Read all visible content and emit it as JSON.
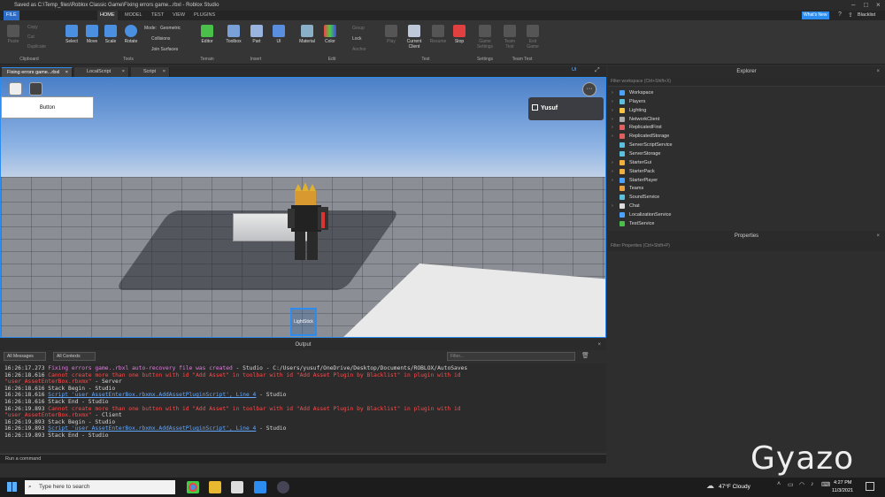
{
  "window": {
    "title": "Saved as C:\\Temp_files\\Roblox Classic Game\\Fixing errors game...rbxl - Roblox Studio"
  },
  "menu": [
    "FILE",
    "HOME",
    "MODEL",
    "TEST",
    "VIEW",
    "PLUGINS"
  ],
  "account": {
    "badge": "What's New",
    "user": "Blacklist"
  },
  "ribbon": {
    "clipboard": {
      "paste": "Paste",
      "copy": "Copy",
      "cut": "Cut",
      "duplicate": "Duplicate",
      "group": "Clipboard"
    },
    "tools": {
      "select": "Select",
      "move": "Move",
      "scale": "Scale",
      "rotate": "Rotate",
      "mode_label": "Mode:",
      "mode_value": "Geometric",
      "collisions": "Collisions",
      "join": "Join Surfaces",
      "group": "Tools"
    },
    "terrain": {
      "editor": "Editor",
      "group": "Terrain"
    },
    "insert": {
      "toolbox": "Toolbox",
      "part": "Part",
      "ui": "UI",
      "group": "Insert"
    },
    "edit": {
      "material": "Material",
      "color": "Color",
      "group_btn": "Group",
      "lock": "Lock",
      "anchor": "Anchor",
      "group": "Edit"
    },
    "test": {
      "play": "Play",
      "current_client": "Current Client",
      "resume": "Resume",
      "stop": "Stop",
      "group": "Test"
    },
    "settings": {
      "game_settings": "Game Settings",
      "group": "Settings"
    },
    "team_test": {
      "team_test": "Team Test",
      "exit_game": "Exit Game",
      "group": "Team Test"
    }
  },
  "doc_tabs": [
    "Fixing errors game...rbxl",
    "LocalScript",
    "Script"
  ],
  "viewport": {
    "button_label": "Button",
    "player_name": "Yusuf",
    "tool_label": "LightStick",
    "ui_label": "UI",
    "more": "···"
  },
  "output": {
    "title": "Output",
    "filter_messages": "All Messages",
    "filter_contexts": "All Contexts",
    "filter_placeholder": "Filter...",
    "lines": [
      {
        "t": "16:26:17.273",
        "parts": [
          {
            "c": "mag",
            "s": "Fixing errors game..rbxl auto-recovery file was created"
          },
          {
            "c": "w",
            "s": "  -  Studio - C:/Users/yusuf/OneDrive/Desktop/Documents/ROBLOX/AutoSaves"
          }
        ]
      },
      {
        "t": "16:26:18.616",
        "parts": [
          {
            "c": "red",
            "s": "Cannot create more than one button with id \"Add Asset\" in toolbar with id \"Add Asset Plugin by Blacklist\" in plugin with id"
          }
        ]
      },
      {
        "t": "",
        "parts": [
          {
            "c": "red",
            "s": "\"user_AssetEnterBox.rbxmx\""
          },
          {
            "c": "w",
            "s": "  -  Server"
          }
        ]
      },
      {
        "t": "16:26:18.616",
        "parts": [
          {
            "c": "w",
            "s": "Stack Begin  -  Studio"
          }
        ]
      },
      {
        "t": "16:26:18.616",
        "parts": [
          {
            "c": "blue",
            "s": "Script 'user_AssetEnterBox.rbxmx.AddAssetPluginScript', Line 4"
          },
          {
            "c": "w",
            "s": "  -  Studio"
          }
        ]
      },
      {
        "t": "16:26:18.616",
        "parts": [
          {
            "c": "w",
            "s": "Stack End  -  Studio"
          }
        ]
      },
      {
        "t": "16:26:19.893",
        "parts": [
          {
            "c": "red",
            "s": "Cannot create more than one button with id \"Add Asset\" in toolbar with id \"Add Asset Plugin by Blacklist\" in plugin with id"
          }
        ]
      },
      {
        "t": "",
        "parts": [
          {
            "c": "red",
            "s": "\"user_AssetEnterBox.rbxmx\""
          },
          {
            "c": "w",
            "s": "  -  Client"
          }
        ]
      },
      {
        "t": "16:26:19.893",
        "parts": [
          {
            "c": "w",
            "s": "Stack Begin  -  Studio"
          }
        ]
      },
      {
        "t": "16:26:19.893",
        "parts": [
          {
            "c": "blue",
            "s": "Script 'user_AssetEnterBox.rbxmx.AddAssetPluginScript', Line 4"
          },
          {
            "c": "w",
            "s": "  -  Studio"
          }
        ]
      },
      {
        "t": "16:26:19.893",
        "parts": [
          {
            "c": "w",
            "s": "Stack End  -  Studio"
          }
        ]
      }
    ],
    "command_placeholder": "Run a command"
  },
  "explorer": {
    "title": "Explorer",
    "filter": "Filter workspace (Ctrl+Shift+X)",
    "items": [
      {
        "label": "Workspace",
        "color": "#4aa3ff",
        "expand": true
      },
      {
        "label": "Players",
        "color": "#5bc0de",
        "expand": true
      },
      {
        "label": "Lighting",
        "color": "#f5c542",
        "expand": true
      },
      {
        "label": "NetworkClient",
        "color": "#aaaaaa",
        "expand": true
      },
      {
        "label": "ReplicatedFirst",
        "color": "#e06060",
        "expand": true
      },
      {
        "label": "ReplicatedStorage",
        "color": "#e06060",
        "expand": true
      },
      {
        "label": "ServerScriptService",
        "color": "#5bc0de",
        "expand": false
      },
      {
        "label": "ServerStorage",
        "color": "#5bc0de",
        "expand": false
      },
      {
        "label": "StarterGui",
        "color": "#f0b040",
        "expand": true
      },
      {
        "label": "StarterPack",
        "color": "#f0b040",
        "expand": true
      },
      {
        "label": "StarterPlayer",
        "color": "#4aa3ff",
        "expand": true
      },
      {
        "label": "Teams",
        "color": "#e8a040",
        "expand": false
      },
      {
        "label": "SoundService",
        "color": "#5bc0de",
        "expand": false
      },
      {
        "label": "Chat",
        "color": "#dddddd",
        "expand": true
      },
      {
        "label": "LocalizationService",
        "color": "#4aa3ff",
        "expand": false
      },
      {
        "label": "TestService",
        "color": "#4ac04a",
        "expand": false
      }
    ]
  },
  "properties": {
    "title": "Properties",
    "filter": "Filter Properties (Ctrl+Shift+P)"
  },
  "taskbar": {
    "search": "Type here to search",
    "weather": "47°F  Cloudy",
    "time": "4:27 PM",
    "date": "11/3/2021"
  },
  "watermark": "Gyazo"
}
